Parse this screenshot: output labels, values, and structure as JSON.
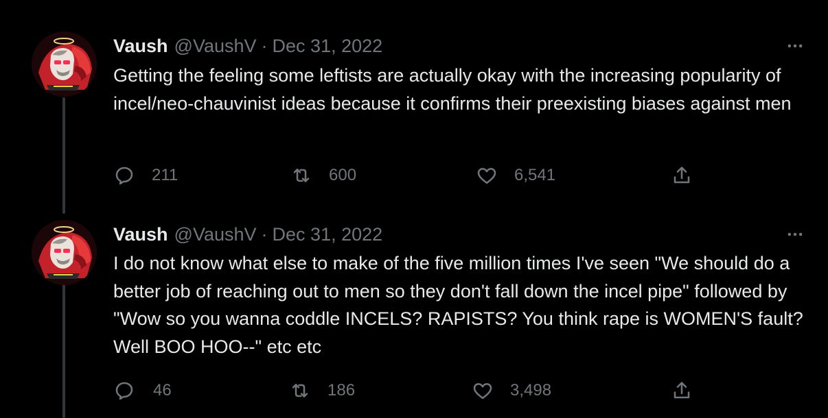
{
  "tweets": [
    {
      "author_name": "Vaush",
      "author_handle": "@VaushV",
      "separator": "·",
      "date": "Dec 31, 2022",
      "text": "Getting the feeling some leftists are actually okay with the increasing popularity of incel/neo-chauvinist ideas because it confirms their preexisting biases against men",
      "replies": "211",
      "retweets": "600",
      "likes": "6,541"
    },
    {
      "author_name": "Vaush",
      "author_handle": "@VaushV",
      "separator": "·",
      "date": "Dec 31, 2022",
      "text": "I do not know what else to make of the five million times I've seen \"We should do a better job of reaching out to men so they don't fall down the incel pipe\" followed by \"Wow so you wanna coddle INCELS? RAPISTS? You think rape is WOMEN'S fault? Well BOO HOO--\" etc etc",
      "replies": "46",
      "retweets": "186",
      "likes": "3,498"
    }
  ],
  "icons": {
    "more": "more-horizontal-icon",
    "reply": "reply-icon",
    "retweet": "retweet-icon",
    "like": "heart-icon",
    "share": "share-icon"
  },
  "colors": {
    "background": "#000000",
    "text_primary": "#e7e9ea",
    "text_secondary": "#71767b",
    "thread_line": "#333639",
    "avatar_accent": "#d62b2b"
  }
}
